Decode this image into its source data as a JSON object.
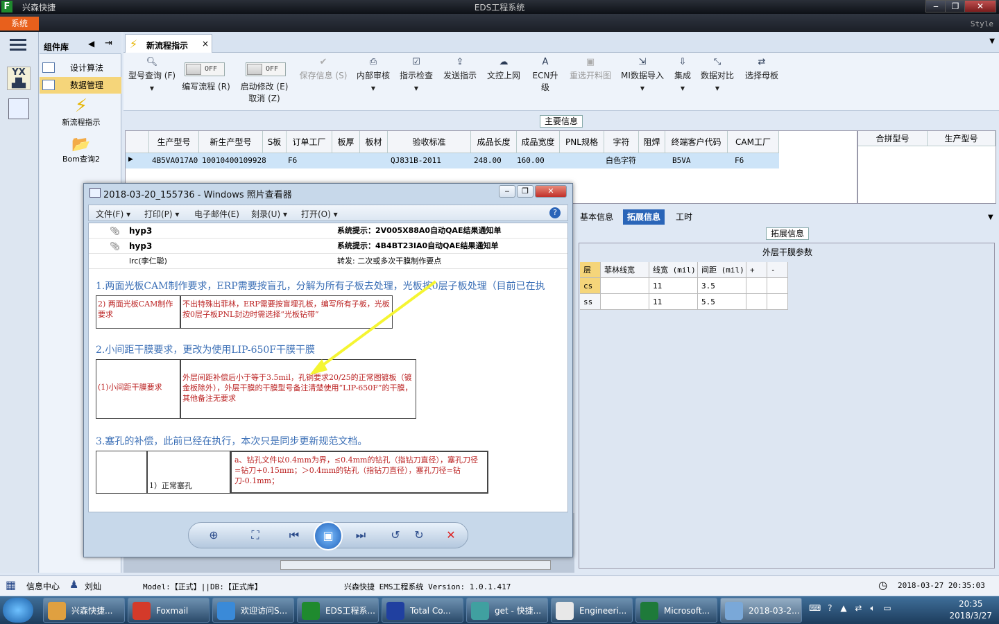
{
  "window": {
    "app_title": "兴森快捷",
    "title": "EDS工程系统",
    "min": "‒",
    "max": "❐",
    "close": "✕"
  },
  "system_menu": "系统",
  "style_label": "Style",
  "component_panel": {
    "title": "组件库",
    "items": [
      {
        "label": "设计算法"
      },
      {
        "label": "数据管理"
      }
    ],
    "tools": [
      {
        "label": "新流程指示"
      },
      {
        "label": "Bom查询2"
      }
    ]
  },
  "tab": {
    "label": "新流程指示",
    "close": "×"
  },
  "toolbar": {
    "model_query": "型号查询 (F)",
    "edit_flow": "编写流程 (R)",
    "start_modify": "启动修改 (E)",
    "cancel": "取消 (Z)",
    "toggle_off": "OFF",
    "buttons": [
      {
        "label": "保存信息 (S)",
        "disabled": true
      },
      {
        "label": "内部审核",
        "disabled": false
      },
      {
        "label": "指示检查",
        "disabled": false
      },
      {
        "label": "发送指示",
        "disabled": false
      },
      {
        "label": "文控上网",
        "disabled": false
      },
      {
        "label": "ECN升级",
        "disabled": false
      },
      {
        "label": "重选开料图",
        "disabled": true
      },
      {
        "label": "MI数据导入",
        "disabled": false
      },
      {
        "label": "集成",
        "disabled": false
      },
      {
        "label": "数据对比",
        "disabled": false
      },
      {
        "label": "选择母板",
        "disabled": false
      }
    ]
  },
  "main_info": {
    "label": "主要信息",
    "columns": [
      "生产型号",
      "新生产型号",
      "S板",
      "订单工厂",
      "板厚",
      "板材",
      "验收标准",
      "成品长度",
      "成品宽度",
      "PNL规格",
      "字符",
      "阻焊",
      "终端客户代码",
      "CAM工厂"
    ],
    "row": [
      "4B5VA017A0",
      "10010400109928",
      "F6",
      "",
      "",
      "",
      "QJ831B-2011",
      "248.00",
      "160.00",
      "",
      "白色字符",
      "",
      "B5VA",
      "F6"
    ],
    "side_columns": [
      "合拼型号",
      "生产型号"
    ]
  },
  "right_tabs": [
    {
      "label": "基本信息"
    },
    {
      "label": "拓展信息"
    },
    {
      "label": "工时"
    }
  ],
  "ext_info": {
    "label": "拓展信息",
    "title": "外层干膜参数",
    "columns": [
      "层",
      "菲林线宽",
      "线宽 (mil)",
      "间距 (mil)",
      "+",
      "-"
    ],
    "rows": [
      [
        "cs",
        "",
        "11",
        "3.5",
        "",
        ""
      ],
      [
        "ss",
        "",
        "11",
        "5.5",
        "",
        ""
      ]
    ]
  },
  "viewer": {
    "title": "2018-03-20_155736 - Windows 照片查看器",
    "menu": [
      "文件(F)",
      "打印(P)",
      "电子邮件(E)",
      "刻录(U)",
      "打开(O)"
    ],
    "help": "?",
    "mails": [
      {
        "from": "hyp3",
        "subject": "系统提示：2V005X88A0自动QAE结果通知单"
      },
      {
        "from": "hyp3",
        "subject": "系统提示：4B4BT23IA0自动QAE结果通知单"
      },
      {
        "from": "lrc(李仁聪)",
        "subject": "转发: 二次或多次干膜制作要点"
      }
    ],
    "doc": {
      "h1": "1.两面光板CAM制作要求，ERP需要按盲孔，分解为所有子板去处理，光板按0层子板处理（目前已在执",
      "b1_left": "2) 两面光板CAM制作要求",
      "b1_right": "不出特殊出菲林，ERP需要按盲埋孔板，编写所有子板，光板按0层子板PNL封边时需选择“光板钻带”",
      "h2": "2.小间距干膜要求，更改为使用LIP-650F干膜干膜",
      "b2_left": "(1)小间距干膜要求",
      "b2_right": "外层间距补偿后小于等于3.5mil，孔铜要求20/25的正常图镀板（镀金板除外），外层干膜的干膜型号备注清楚使用“LIP-650F”的干膜，其他备注无要求",
      "h3": "3.塞孔的补偿，此前已经在执行，本次只是同步更新规范文档。",
      "b3_left": "1）正常塞孔",
      "b3_right": "a、钻孔文件以0.4mm为界，≤0.4mm的钻孔（指钻刀直径），塞孔刀径=钻刀+0.15mm；＞0.4mm的钻孔（指钻刀直径），塞孔刀径=钻刀-0.1mm；"
    }
  },
  "status": {
    "info_center": "信息中心",
    "user": "刘灿",
    "model": "Model:【正式】||DB:【正式库】",
    "system": "兴森快捷 EMS工程系统 Version: 1.0.1.417",
    "datetime": "2018-03-27 20:35:03"
  },
  "taskbar": {
    "items": [
      {
        "label": "兴森快捷..."
      },
      {
        "label": "Foxmail"
      },
      {
        "label": "欢迎访问S..."
      },
      {
        "label": "EDS工程系..."
      },
      {
        "label": "Total Co..."
      },
      {
        "label": "get - 快捷..."
      },
      {
        "label": "Engineeri..."
      },
      {
        "label": "Microsoft..."
      },
      {
        "label": "2018-03-2..."
      }
    ],
    "time": "20:35",
    "date": "2018/3/27"
  }
}
